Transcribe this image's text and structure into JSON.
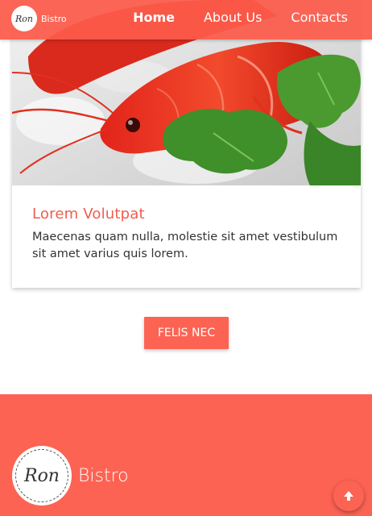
{
  "header": {
    "logo_text": "Ron",
    "brand": "Bistro",
    "nav": [
      {
        "label": "Home",
        "active": true
      },
      {
        "label": "About Us",
        "active": false
      },
      {
        "label": "Contacts",
        "active": false
      }
    ]
  },
  "card": {
    "image_subject": "red-shrimp-with-parsley-on-ice",
    "title": "Lorem Volutpat",
    "text": "Maecenas quam nulla, molestie sit amet vestibulum sit amet varius quis lorem."
  },
  "cta": {
    "label": "FELIS NEC"
  },
  "footer": {
    "logo_text": "Ron",
    "brand": "Bistro"
  },
  "icons": {
    "scroll_top": "arrow-up-icon"
  },
  "colors": {
    "accent": "#fd6353",
    "title": "#ef5d4e",
    "text": "#333333",
    "background": "#ffffff"
  }
}
